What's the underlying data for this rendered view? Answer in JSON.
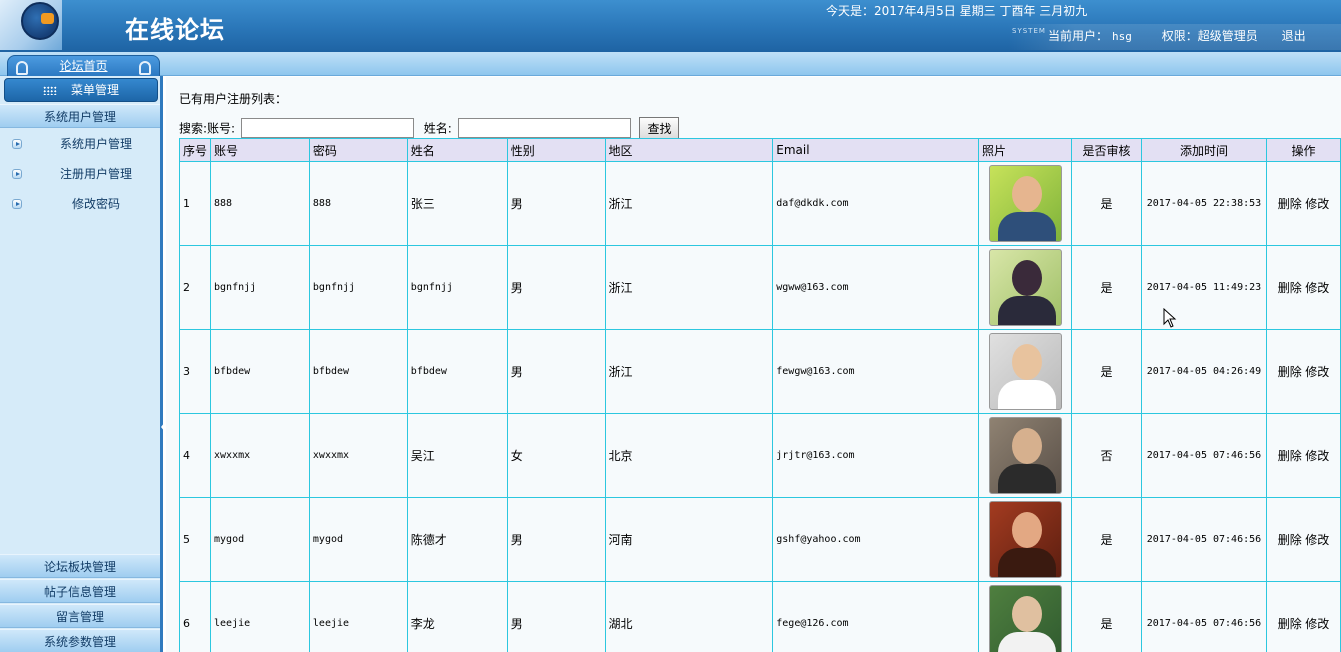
{
  "header": {
    "title": "在线论坛",
    "date_line": "今天是：2017年4月5日   星期三   丁酉年  三月初九",
    "system_small": "SYSTEM",
    "current_user_label": "当前用户：",
    "current_user": "hsg",
    "permission": "权限：超级管理员",
    "logout": "退出"
  },
  "nav": {
    "home_tab": "论坛首页",
    "menu_title": "菜单管理"
  },
  "sidebar": {
    "top_group": "系统用户管理",
    "items": [
      {
        "label": "系统用户管理"
      },
      {
        "label": "注册用户管理"
      },
      {
        "label": "修改密码"
      }
    ],
    "bottom_groups": [
      {
        "label": "论坛板块管理"
      },
      {
        "label": "帖子信息管理"
      },
      {
        "label": "留言管理"
      },
      {
        "label": "系统参数管理"
      }
    ]
  },
  "main": {
    "list_title": "已有用户注册列表：",
    "search": {
      "prefix": "搜索:账号:",
      "name_label": "姓名:",
      "account_value": "",
      "name_value": "",
      "button": "查找"
    },
    "table": {
      "headers": [
        "序号",
        "账号",
        "密码",
        "姓名",
        "性别",
        "地区",
        "Email",
        "照片",
        "是否审核",
        "添加时间",
        "操作"
      ],
      "delete_label": "删除",
      "edit_label": "修改",
      "rows": [
        {
          "no": "1",
          "account": "888",
          "password": "888",
          "name": "张三",
          "gender": "男",
          "region": "浙江",
          "email": "daf@dkdk.com",
          "approved": "是",
          "added": "2017-04-05 22:38:53",
          "photo": "photo-young-man"
        },
        {
          "no": "2",
          "account": "bgnfnjj",
          "password": "bgnfnjj",
          "name": "bgnfnjj",
          "gender": "男",
          "region": "浙江",
          "email": "wgww@163.com",
          "approved": "是",
          "added": "2017-04-05 11:49:23",
          "photo": "photo-anime-character"
        },
        {
          "no": "3",
          "account": "bfbdew",
          "password": "bfbdew",
          "name": "bfbdew",
          "gender": "男",
          "region": "浙江",
          "email": "fewgw@163.com",
          "approved": "是",
          "added": "2017-04-05 04:26:49",
          "photo": "photo-cartoon-sunglasses"
        },
        {
          "no": "4",
          "account": "xwxxmx",
          "password": "xwxxmx",
          "name": "吴江",
          "gender": "女",
          "region": "北京",
          "email": "jrjtr@163.com",
          "approved": "否",
          "added": "2017-04-05 07:46:56",
          "photo": "photo-man-at-desk"
        },
        {
          "no": "5",
          "account": "mygod",
          "password": "mygod",
          "name": "陈德才",
          "gender": "男",
          "region": "河南",
          "email": "gshf@yahoo.com",
          "approved": "是",
          "added": "2017-04-05 07:46:56",
          "photo": "photo-man-portrait"
        },
        {
          "no": "6",
          "account": "leejie",
          "password": "leejie",
          "name": "李龙",
          "gender": "男",
          "region": "湖北",
          "email": "fege@126.com",
          "approved": "是",
          "added": "2017-04-05 07:46:56",
          "photo": "photo-man-outdoors"
        }
      ]
    }
  },
  "colors": {
    "header_blue": "#2a76b8",
    "sidebar_bg": "#d6ebf9",
    "table_border": "#2cc7df",
    "table_header_bg": "#e3e0f3"
  }
}
